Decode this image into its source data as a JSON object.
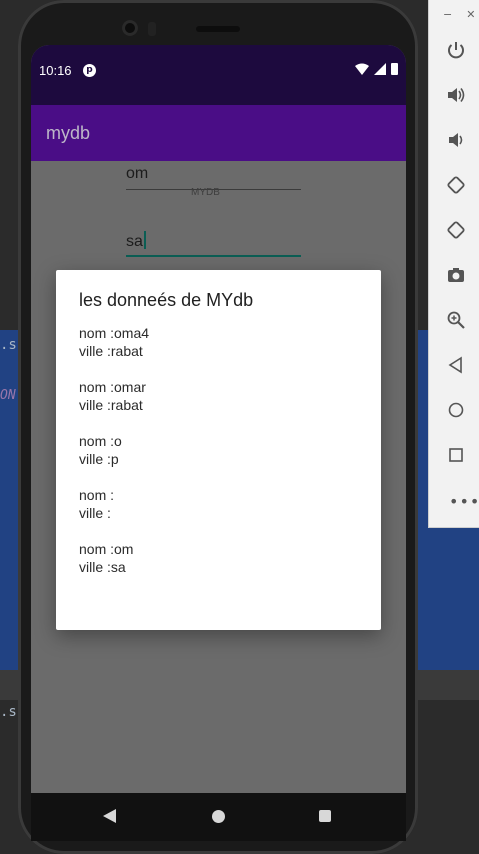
{
  "ide": {
    "fragment_1": ".s",
    "fragment_2": "ON",
    "fragment_3": ".s"
  },
  "status_bar": {
    "time": "10:16"
  },
  "app_bar": {
    "title": "mydb"
  },
  "form": {
    "field_name_value": "om",
    "field_name_hint": "MYDB",
    "field_city_value": "sa"
  },
  "dialog": {
    "title": "les donneés de MYdb",
    "body": "nom :oma4\nville :rabat\n\nnom :omar\nville :rabat\n\nnom :o\nville :p\n\nnom :\nville :\n\nnom :om\nville :sa"
  },
  "emulator_toolbar": {
    "minimize": "−",
    "close": "✕",
    "more": "•••"
  },
  "colors": {
    "status_bar": "#1d0a3e",
    "app_bar": "#4a0d86",
    "accent": "#0b5e54"
  }
}
